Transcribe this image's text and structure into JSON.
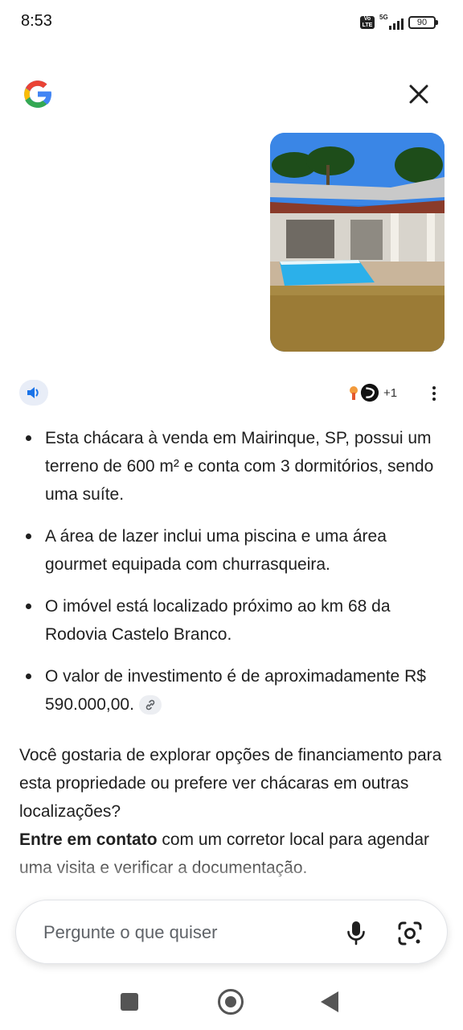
{
  "status_bar": {
    "time": "8:53",
    "network": "5G",
    "volte": "Vo LTE",
    "battery": "90"
  },
  "header": {
    "logo_icon": "google-g-icon",
    "close_icon": "close-icon"
  },
  "uploaded_image": {
    "description_icon": "house-with-pool-photo"
  },
  "actions": {
    "speak_icon": "speaker-icon",
    "sources_more": "+1",
    "more_icon": "more-vertical-icon"
  },
  "answer": {
    "bullets": [
      "Esta chácara à venda em Mairinque, SP, possui um terreno de 600 m² e conta com 3 dormitórios, sendo uma suíte.",
      "A área de lazer inclui uma piscina e uma área gourmet equipada com churrasqueira.",
      "O imóvel está localizado próximo ao km 68 da Rodovia Castelo Branco.",
      "O valor de investimento é de aproximadamente R$ 590.000,00."
    ],
    "question": "Você gostaria de explorar opções de financiamento para esta propriedade ou prefere ver chácaras em outras localizações?",
    "cta_bold": "Entre em contato",
    "cta_rest": " com um corretor local para agendar uma visita e verificar a documentação."
  },
  "input": {
    "placeholder": "Pergunte o que quiser"
  },
  "colors": {
    "accent": "#1a73e8",
    "speak_bg": "#e8edf7",
    "text": "#1f1f1f"
  }
}
